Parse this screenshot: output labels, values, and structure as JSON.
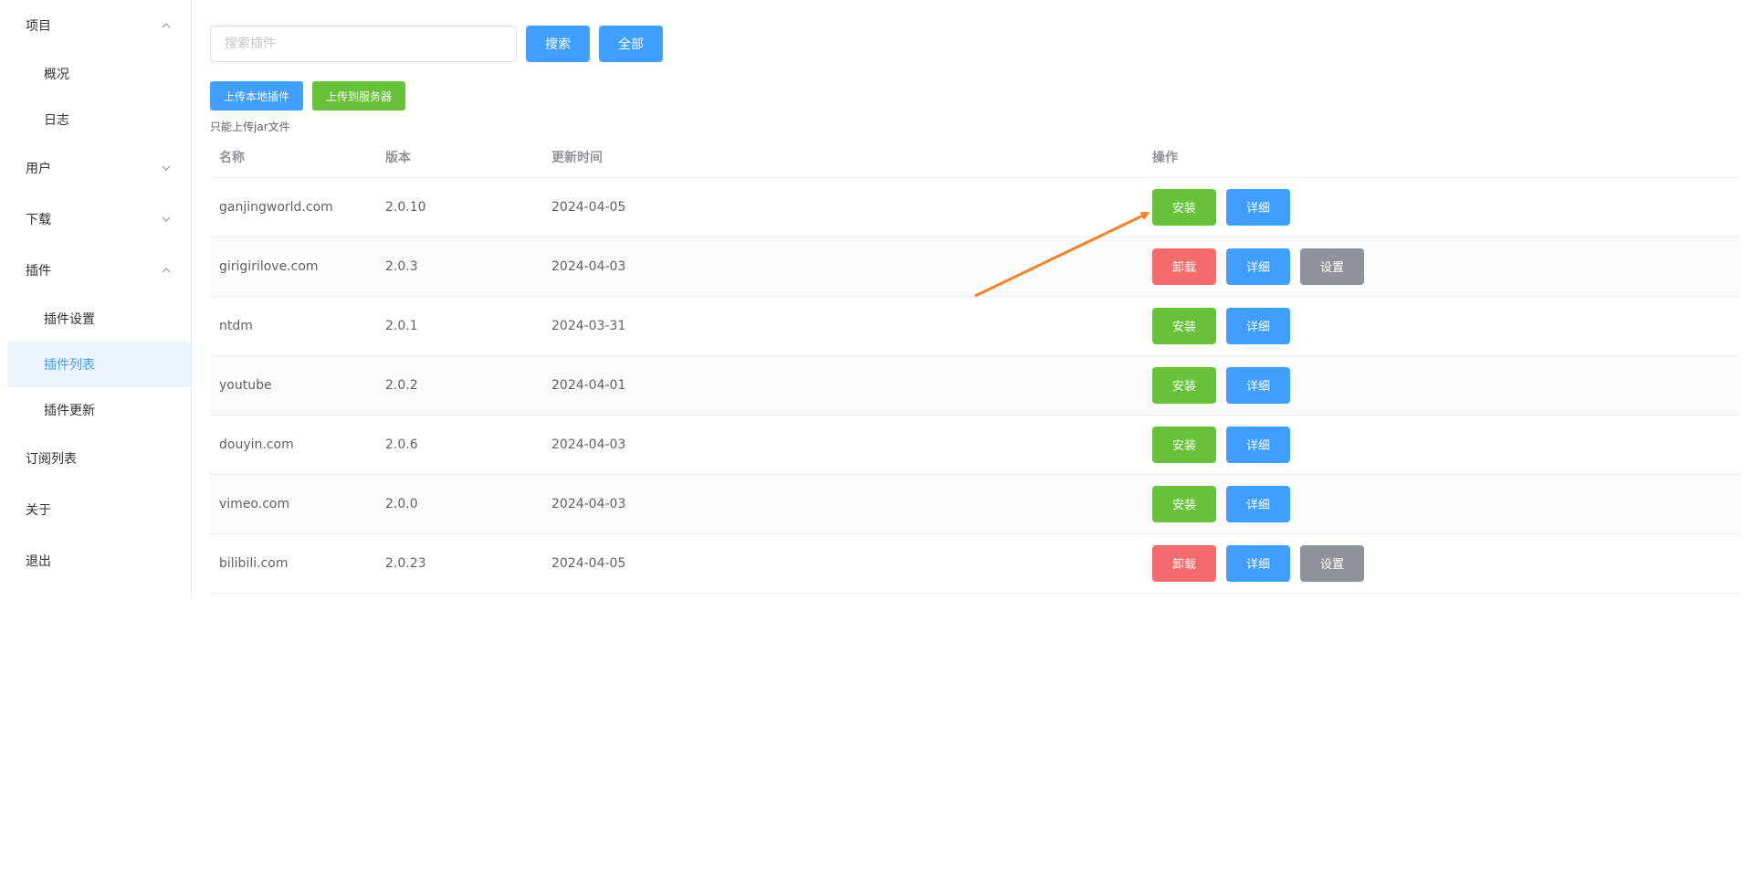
{
  "sidebar": {
    "items": [
      {
        "label": "项目",
        "type": "group",
        "expanded": true
      },
      {
        "label": "概况",
        "type": "sub"
      },
      {
        "label": "日志",
        "type": "sub"
      },
      {
        "label": "用户",
        "type": "group",
        "expanded": false
      },
      {
        "label": "下载",
        "type": "group",
        "expanded": false
      },
      {
        "label": "插件",
        "type": "group",
        "expanded": true
      },
      {
        "label": "插件设置",
        "type": "sub"
      },
      {
        "label": "插件列表",
        "type": "sub",
        "active": true
      },
      {
        "label": "插件更新",
        "type": "sub"
      },
      {
        "label": "订阅列表",
        "type": "item"
      },
      {
        "label": "关于",
        "type": "item"
      },
      {
        "label": "退出",
        "type": "item"
      }
    ]
  },
  "search": {
    "placeholder": "搜索插件",
    "search_label": "搜索",
    "all_label": "全部"
  },
  "upload": {
    "local_label": "上传本地插件",
    "server_label": "上传到服务器",
    "tip": "只能上传jar文件"
  },
  "table": {
    "headers": {
      "name": "名称",
      "version": "版本",
      "updated": "更新时间",
      "actions": "操作"
    },
    "rows": [
      {
        "name": "ganjingworld.com",
        "version": "2.0.10",
        "updated": "2024-04-05",
        "installed": false
      },
      {
        "name": "girigirilove.com",
        "version": "2.0.3",
        "updated": "2024-04-03",
        "installed": true
      },
      {
        "name": "ntdm",
        "version": "2.0.1",
        "updated": "2024-03-31",
        "installed": false
      },
      {
        "name": "youtube",
        "version": "2.0.2",
        "updated": "2024-04-01",
        "installed": false
      },
      {
        "name": "douyin.com",
        "version": "2.0.6",
        "updated": "2024-04-03",
        "installed": false
      },
      {
        "name": "vimeo.com",
        "version": "2.0.0",
        "updated": "2024-04-03",
        "installed": false
      },
      {
        "name": "bilibili.com",
        "version": "2.0.23",
        "updated": "2024-04-05",
        "installed": true
      }
    ],
    "action_labels": {
      "install": "安装",
      "uninstall": "卸载",
      "detail": "详细",
      "settings": "设置"
    }
  },
  "colors": {
    "primary": "#409eff",
    "success": "#67c23a",
    "danger": "#f56c6c",
    "info": "#909399",
    "annotation_arrow": "#f5822a"
  }
}
